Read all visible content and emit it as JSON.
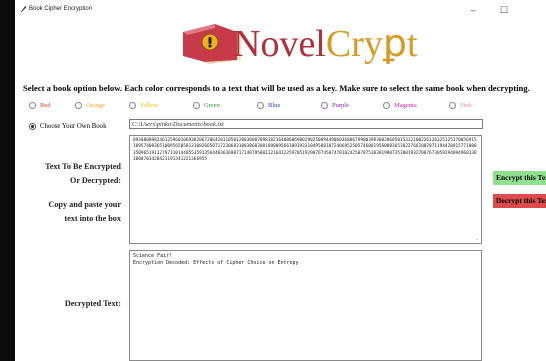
{
  "window": {
    "title": "Book Cipher Encryption",
    "minimize": "–",
    "maximize": "☐"
  },
  "brand": {
    "part1": "Novel",
    "part2": "Cryꝑt"
  },
  "instruction": "Select a book option below. Each color corresponds to a text that will be used as a key. Make sure to select the same book when decrypting.",
  "colors": [
    {
      "label": "Red",
      "color": "#e53935"
    },
    {
      "label": "Orange",
      "color": "#f5a623"
    },
    {
      "label": "Yellow",
      "color": "#e6c200"
    },
    {
      "label": "Green",
      "color": "#2e9a3a"
    },
    {
      "label": "Blue",
      "color": "#1f3fd6"
    },
    {
      "label": "Purple",
      "color": "#8e24aa"
    },
    {
      "label": "Magenta",
      "color": "#d81b9c"
    },
    {
      "label": "Pink",
      "color": "#f48fb1"
    }
  ],
  "own_book": {
    "label": "Choose Your Own Book",
    "path": "C:\\Users\\pinko\\Documents\\book.txt"
  },
  "labels": {
    "encrypt_1": "Text To Be Encrypted",
    "encrypt_2": "Or Decrypted:",
    "copy_1": "Copy and paste your",
    "copy_2": "text into the box",
    "decrypted": "Decrypted Text:"
  },
  "encrypted_text": "0930800982461259601069302067206420110501200308078983021640060690029025089449060368067990039830028605015332100226126325125170056915109574083651009565058131082665071723068310038683081090095661091933104950010724069525057460019560083651022766100707119442091577100035096519132797110144055359135644036369071714079588132164122597051929076745074701024250787510381980735380193270076730592940949601381800703420421191341221366955",
  "decrypted_text": "Science Fair!\nEncryption Decoded: Effects of Cipher Choice on Entropy",
  "buttons": {
    "encrypt": "Encrypt this Text",
    "decrypt": "Decrypt this Text"
  },
  "scroll_glyph": "⌄"
}
